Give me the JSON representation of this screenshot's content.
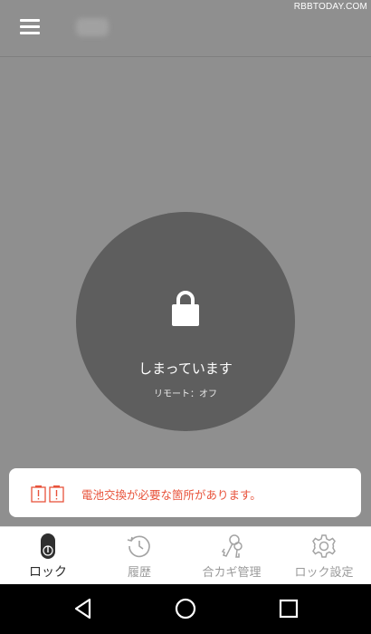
{
  "watermark": "RBBTODAY.COM",
  "lock": {
    "status": "しまっています",
    "remote": "リモート：オフ"
  },
  "alert": {
    "message": "電池交換が必要な箇所があります。"
  },
  "tabs": [
    {
      "label": "ロック",
      "icon": "lock-device-icon",
      "active": true
    },
    {
      "label": "履歴",
      "icon": "history-icon",
      "active": false
    },
    {
      "label": "合カギ管理",
      "icon": "keys-icon",
      "active": false
    },
    {
      "label": "ロック設定",
      "icon": "gear-icon",
      "active": false
    }
  ],
  "nav": [
    "back",
    "home",
    "recents"
  ]
}
